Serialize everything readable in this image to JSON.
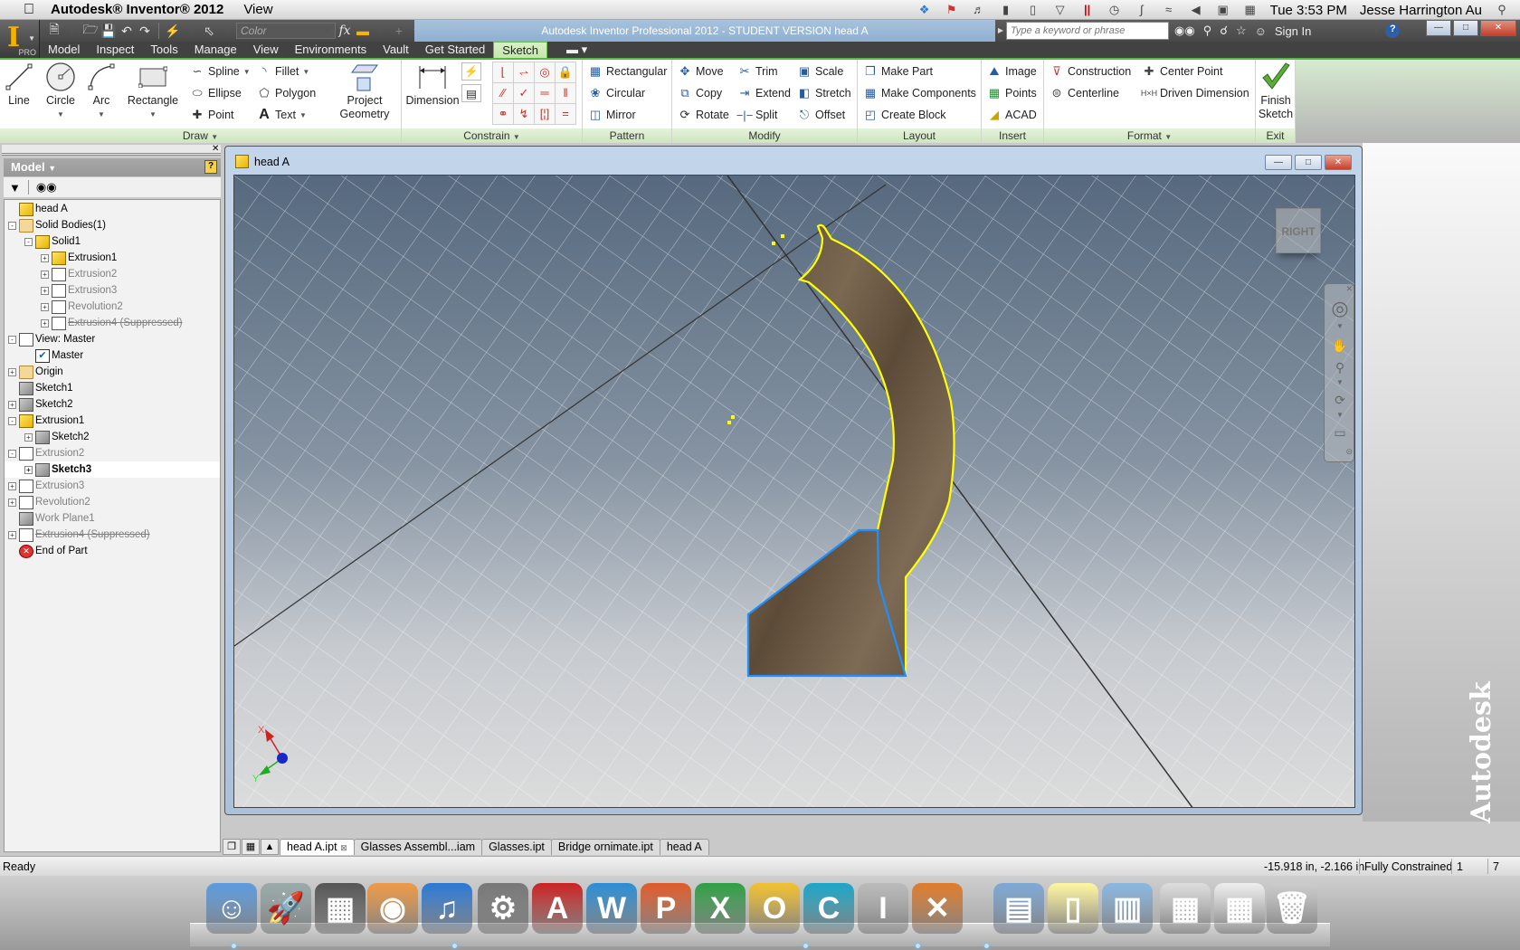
{
  "mac_menubar": {
    "apple_icon": "apple-icon",
    "app_name": "Autodesk® Inventor® 2012",
    "menus": [
      "View"
    ],
    "status_icons": [
      "dropbox-icon",
      "flag-icon",
      "volume-icon",
      "battery-icon",
      "device-icon",
      "triangle-icon",
      "parallels-icon",
      "time-machine-icon",
      "bluetooth-icon",
      "wifi-icon",
      "speaker-icon",
      "display-icon",
      "calendar-icon"
    ],
    "clock": "Tue 3:53 PM",
    "user": "Jesse Harrington Au",
    "spotlight_icon": "search-icon"
  },
  "app": {
    "badge": "PRO",
    "window_title": "Autodesk Inventor Professional 2012 - STUDENT VERSION    head A",
    "color_box": "Color",
    "search_placeholder": "Type a keyword or phrase",
    "sign_in": "Sign In"
  },
  "ribbon_tabs": [
    "Model",
    "Inspect",
    "Tools",
    "Manage",
    "View",
    "Environments",
    "Vault",
    "Get Started",
    "Sketch"
  ],
  "active_tab": "Sketch",
  "ribbon": {
    "draw": {
      "label": "Draw",
      "big": [
        "Line",
        "Circle",
        "Arc",
        "Rectangle"
      ],
      "small": [
        "Spline",
        "Ellipse",
        "Point",
        "Fillet",
        "Polygon",
        "Text"
      ],
      "project_geometry": [
        "Project",
        "Geometry"
      ]
    },
    "constrain": {
      "label": "Constrain",
      "dimension": "Dimension"
    },
    "pattern": {
      "label": "Pattern",
      "items": [
        "Rectangular",
        "Circular",
        "Mirror"
      ]
    },
    "modify": {
      "label": "Modify",
      "items": [
        "Move",
        "Copy",
        "Rotate",
        "Trim",
        "Extend",
        "Split",
        "Scale",
        "Stretch",
        "Offset"
      ]
    },
    "layout": {
      "label": "Layout",
      "items": [
        "Make Part",
        "Make Components",
        "Create Block"
      ]
    },
    "insert": {
      "label": "Insert",
      "items": [
        "Image",
        "Points",
        "ACAD"
      ]
    },
    "format": {
      "label": "Format",
      "items": [
        "Construction",
        "Centerline",
        "Center Point",
        "Driven Dimension"
      ]
    },
    "exit": {
      "label": "Exit",
      "finish": [
        "Finish",
        "Sketch"
      ]
    }
  },
  "browser": {
    "title": "Model",
    "tree": [
      {
        "label": "head A",
        "level": 0,
        "icon": "part",
        "state": "normal"
      },
      {
        "label": "Solid Bodies(1)",
        "level": 0,
        "icon": "folder",
        "state": "normal",
        "expander": "-"
      },
      {
        "label": "Solid1",
        "level": 1,
        "icon": "part",
        "state": "normal",
        "expander": "-"
      },
      {
        "label": "Extrusion1",
        "level": 2,
        "icon": "extrude-active",
        "state": "normal",
        "expander": "+"
      },
      {
        "label": "Extrusion2",
        "level": 2,
        "icon": "extrude",
        "state": "dim",
        "expander": "+"
      },
      {
        "label": "Extrusion3",
        "level": 2,
        "icon": "extrude",
        "state": "dim",
        "expander": "+"
      },
      {
        "label": "Revolution2",
        "level": 2,
        "icon": "revolve",
        "state": "dim",
        "expander": "+"
      },
      {
        "label": "Extrusion4 (Suppressed)",
        "level": 2,
        "icon": "extrude",
        "state": "strike",
        "expander": "+"
      },
      {
        "label": "View: Master",
        "level": 0,
        "icon": "view",
        "state": "normal",
        "expander": "-"
      },
      {
        "label": "Master",
        "level": 1,
        "icon": "check-lock",
        "state": "normal"
      },
      {
        "label": "Origin",
        "level": 0,
        "icon": "folder",
        "state": "normal",
        "expander": "+"
      },
      {
        "label": "Sketch1",
        "level": 0,
        "icon": "sketch",
        "state": "normal"
      },
      {
        "label": "Sketch2",
        "level": 0,
        "icon": "sketch",
        "state": "normal",
        "expander": "+"
      },
      {
        "label": "Extrusion1",
        "level": 0,
        "icon": "extrude-active",
        "state": "normal",
        "expander": "-"
      },
      {
        "label": "Sketch2",
        "level": 1,
        "icon": "sketch",
        "state": "normal",
        "expander": "+"
      },
      {
        "label": "Extrusion2",
        "level": 0,
        "icon": "extrude",
        "state": "dim",
        "expander": "-"
      },
      {
        "label": "Sketch3",
        "level": 1,
        "icon": "sketch",
        "state": "selected",
        "expander": "+"
      },
      {
        "label": "Extrusion3",
        "level": 0,
        "icon": "extrude",
        "state": "dim",
        "expander": "+"
      },
      {
        "label": "Revolution2",
        "level": 0,
        "icon": "revolve",
        "state": "dim",
        "expander": "+"
      },
      {
        "label": "Work Plane1",
        "level": 0,
        "icon": "workplane",
        "state": "dim"
      },
      {
        "label": "Extrusion4 (Suppressed)",
        "level": 0,
        "icon": "extrude",
        "state": "strike",
        "expander": "+"
      },
      {
        "label": "End of Part",
        "level": 0,
        "icon": "end",
        "state": "normal"
      }
    ]
  },
  "document": {
    "title": "head A",
    "viewcube_label": "RIGHT",
    "triad": {
      "x": "X",
      "y": "Y"
    },
    "colors": {
      "profile": "#ffff00",
      "selected": "#1e90ff",
      "wood": "#6b5a45"
    }
  },
  "doc_tabs": [
    "head A.ipt",
    "Glasses Assembl...iam",
    "Glasses.ipt",
    "Bridge ornimate.ipt",
    "head A"
  ],
  "status": {
    "left": "Ready",
    "coords": "-15.918 in, -2.166 in",
    "constraint": "Fully Constrained",
    "val1": "1",
    "val2": "7"
  },
  "watermark": "Autodesk",
  "dock": [
    "Finder",
    "Launchpad",
    "Photo Booth",
    "Chrome",
    "iTunes",
    "System Preferences",
    "AutoCAD",
    "Word",
    "PowerPoint",
    "Excel",
    "Outlook",
    "Cura",
    "Inventor",
    "Xcode",
    "Documents",
    "Notes",
    "Windows",
    "Preview",
    "Safari Chrome",
    "Trash"
  ]
}
